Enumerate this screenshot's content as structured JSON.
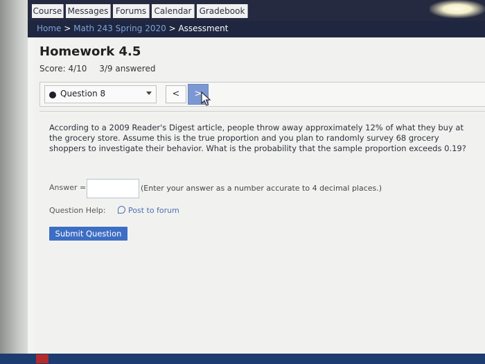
{
  "nav": {
    "tabs": [
      "Course",
      "Messages",
      "Forums",
      "Calendar",
      "Gradebook"
    ]
  },
  "breadcrumb": {
    "home": "Home",
    "sep1": " > ",
    "course": "Math 243 Spring 2020",
    "sep2": " > ",
    "current": "Assessment"
  },
  "page": {
    "title": "Homework 4.5",
    "score": "Score: 4/10",
    "answered": "3/9 answered"
  },
  "question_nav": {
    "selected": "Question 8",
    "prev_label": "<",
    "next_label": ">"
  },
  "question": {
    "text": "According to a 2009 Reader's Digest article, people throw away approximately 12% of what they buy at the grocery store. Assume this is the true proportion and you plan to randomly survey 68 grocery shoppers to investigate their behavior. What is the probability that the sample proportion exceeds 0.19?",
    "answer_label": "Answer =",
    "answer_value": "",
    "answer_hint": "(Enter your answer as a number accurate to 4 decimal places.)",
    "help_label": "Question Help:",
    "forum_link": "Post to forum",
    "submit_label": "Submit Question"
  }
}
